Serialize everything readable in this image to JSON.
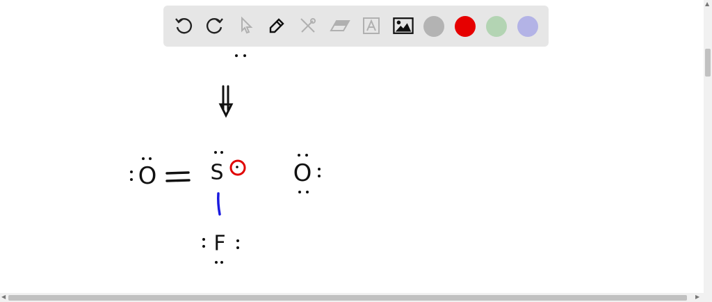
{
  "toolbar": {
    "tools": [
      "undo-icon",
      "redo-icon",
      "pointer-icon",
      "pen-icon",
      "tools-icon",
      "eraser-icon",
      "text-icon",
      "image-icon"
    ],
    "colors": [
      "#b3b3b3",
      "#e60000",
      "#b3d4b3",
      "#b3b3e6"
    ]
  },
  "drawing": {
    "atoms": {
      "o_left": "O",
      "s": "S",
      "o_right": "O",
      "f": "F"
    },
    "ink": "#111111",
    "bond_color": "#1a1adf",
    "circle_color": "#e00000"
  }
}
